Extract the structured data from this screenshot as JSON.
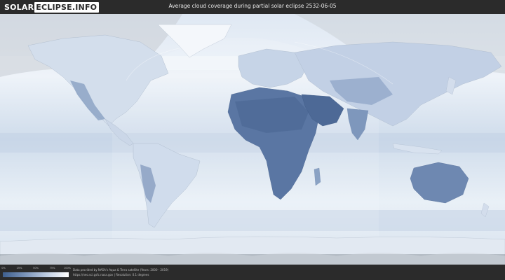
{
  "header": {
    "logo_left": "SOLAR",
    "logo_right": "ECLIPSE.INFO",
    "title": "Average cloud coverage during partial solar eclipse 2532-06-05"
  },
  "footer": {
    "legend_ticks": [
      "0%",
      "25%",
      "50%",
      "75%",
      "100%"
    ],
    "credit_line1": "Data provided by NASA's Aqua & Terra satellite (Years: 2000 - 2019)",
    "credit_line2": "https://neo.sci.gsfc.nasa.gov | Resolution: 0.1 degrees"
  },
  "colors": {
    "background": "#2b2b2b",
    "ocean_clouds": "#e6edf6",
    "land_clear": "#5a76a3",
    "ice": "#f7fafd",
    "night_shadow": "#c9cfd6",
    "legend_start": "#3e5f8e",
    "legend_end": "#ffffff"
  }
}
